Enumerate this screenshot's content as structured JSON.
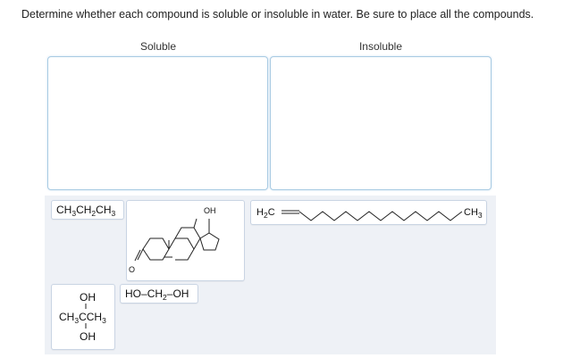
{
  "instruction": "Determine whether each compound is soluble or insoluble in water. Be sure to place all the compounds.",
  "bins": {
    "soluble_label": "Soluble",
    "insoluble_label": "Insoluble"
  },
  "compounds": {
    "propane": {
      "parts": [
        "CH",
        "3",
        "CH",
        "2",
        "CH",
        "3"
      ]
    },
    "steroid": {
      "oh_label": "OH",
      "o_label": "O"
    },
    "alkene": {
      "h2c_h": "H",
      "h2c_2": "2",
      "h2c_c": "C",
      "ch3_ch": "CH",
      "ch3_3": "3"
    },
    "diol": {
      "ho": "HO",
      "ch2_ch": "CH",
      "ch2_2": "2",
      "oh": "OH"
    },
    "glycol": {
      "top_oh": "OH",
      "mid_ch": "CH",
      "mid_3": "3",
      "mid_cc": "CCH",
      "mid_3b": "3",
      "bottom_oh": "OH"
    }
  },
  "colors": {
    "bin_border": "#a9cbe3",
    "bank_bg": "#eef1f6",
    "card_border": "#c9d4e3"
  }
}
